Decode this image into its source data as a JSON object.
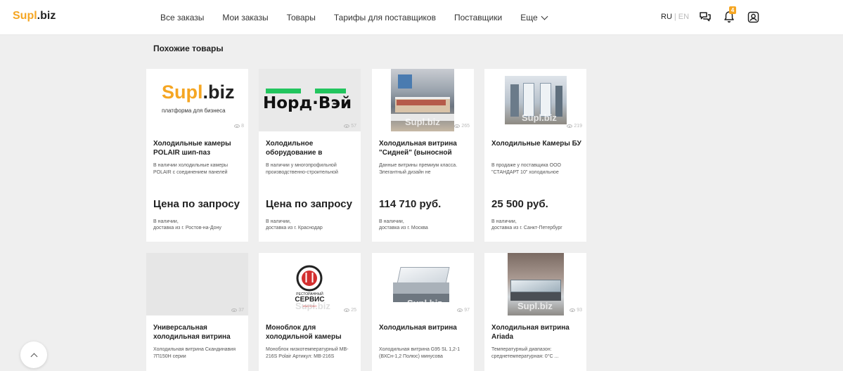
{
  "header": {
    "logo_a": "Supl",
    "logo_b": ".biz",
    "nav": [
      "Все заказы",
      "Мои заказы",
      "Товары",
      "Тарифы для поставщиков",
      "Поставщики",
      "Еще"
    ],
    "lang_ru": "RU",
    "lang_sep": "|",
    "lang_en": "EN",
    "notification_count": "4"
  },
  "section_title": "Похожие товары",
  "cards": [
    {
      "title": "Холодильные камеры POLAIR шип-паз",
      "desc": "В наличии холодильные камеры POLAIR с соединением панелей",
      "price": "Цена по запросу",
      "avail1": "В наличии,",
      "avail2": "доставка из г. Ростов-на-Дону",
      "views": "8",
      "logo_main_a": "Supl",
      "logo_main_b": ".biz",
      "logo_sub": "платформа для бизнеса"
    },
    {
      "title": "Холодильное оборудование в",
      "desc": "В наличии у многопрофильной производственно-строительной",
      "price": "Цена по запросу",
      "avail1": "В наличии,",
      "avail2": "доставка из г. Краснодар",
      "views": "57",
      "brand": "Норд·Вэй"
    },
    {
      "title": "Холодильная витрина \"Сидней\" (выносной",
      "desc": "Данные витрины премиум класса. Элегантный дизайн не",
      "price": "114 710 руб.",
      "avail1": "В наличии,",
      "avail2": "доставка из г. Москва",
      "views": "265",
      "watermark": "Supl.biz"
    },
    {
      "title": "Холодильные Камеры БУ",
      "desc": "В продаже у поставщика ООО \"СТАНДАРТ 10\" холодильное",
      "price": "25 500 руб.",
      "avail1": "В наличии,",
      "avail2": "доставка из г. Санкт-Петербург",
      "views": "219",
      "watermark": "Supl.biz"
    },
    {
      "title": "Универсальная холодильная витрина",
      "desc": "Холодильная витрина Скандинавия 7П150Н серии",
      "views": "37"
    },
    {
      "title": "Моноблок для холодильной камеры",
      "desc": "Моноблок низкотемпературный MB-216S Polair Артикул: MB-216S",
      "views": "25",
      "seal_top": "РЕСТОРАННЫЙ",
      "seal_main": "СЕРВИС",
      "seal_bottom": "ИВАНОВО",
      "watermark": "Supl.biz"
    },
    {
      "title": "Холодильная витрина",
      "desc": "Холодильная витрина G95 SL 1,2-1 (ВХСн-1,2 Полюс) минусова",
      "views": "97",
      "watermark": "Supl.biz"
    },
    {
      "title": "Холодильная витрина Ariada",
      "desc": "Температурный диапазон: среднетемпературная: 0°С ...",
      "views": "93",
      "watermark": "Supl.biz"
    }
  ],
  "icons": {
    "chat": "chat-icon",
    "bell": "bell-icon",
    "profile": "user-icon",
    "scroll_top": "chevron-up-icon",
    "views": "eye-icon"
  },
  "colors": {
    "brand_orange": "#f5a623",
    "background": "#efefef",
    "nordway_green": "#22c55e"
  }
}
